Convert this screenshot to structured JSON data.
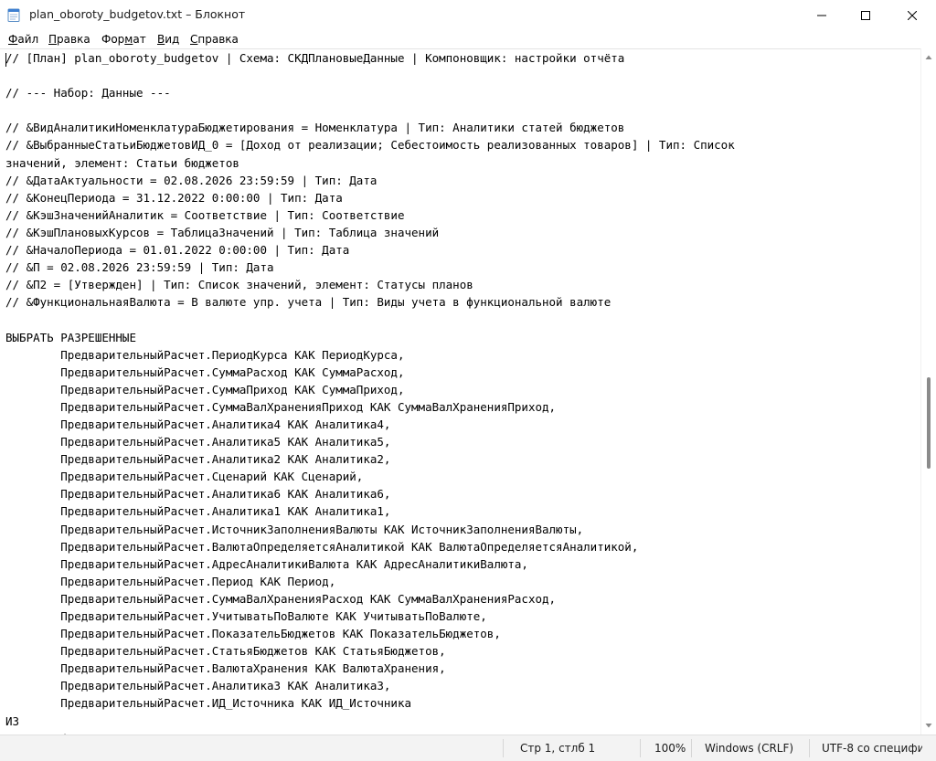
{
  "window": {
    "title": "plan_oboroty_budgetov.txt – Блокнот",
    "icon": "notepad-icon"
  },
  "menu": {
    "items": [
      {
        "underline": "Ф",
        "rest": "айл"
      },
      {
        "underline": "П",
        "rest": "равка"
      },
      {
        "pre": "Фор",
        "underline": "м",
        "rest": "ат"
      },
      {
        "underline": "В",
        "rest": "ид"
      },
      {
        "underline": "С",
        "rest": "правка"
      }
    ]
  },
  "editor": {
    "lines": [
      "// [План] plan_oboroty_budgetov | Схема: СКДПлановыеДанные | Компоновщик: настройки отчёта",
      "",
      "// --- Набор: Данные ---",
      "",
      "// &ВидАналитикиНоменклатураБюджетирования = Номенклатура | Тип: Аналитики статей бюджетов",
      "// &ВыбранныеСтатьиБюджетовИД_0 = [Доход от реализации; Себестоимость реализованных товаров] | Тип: Список",
      "значений, элемент: Статьи бюджетов",
      "// &ДатаАктуальности = 02.08.2026 23:59:59 | Тип: Дата",
      "// &КонецПериода = 31.12.2022 0:00:00 | Тип: Дата",
      "// &КэшЗначенийАналитик = Соответствие | Тип: Соответствие",
      "// &КэшПлановыхКурсов = ТаблицаЗначений | Тип: Таблица значений",
      "// &НачалоПериода = 01.01.2022 0:00:00 | Тип: Дата",
      "// &П = 02.08.2026 23:59:59 | Тип: Дата",
      "// &П2 = [Утвержден] | Тип: Список значений, элемент: Статусы планов",
      "// &ФункциональнаяВалюта = В валюте упр. учета | Тип: Виды учета в функциональной валюте",
      "",
      "ВЫБРАТЬ РАЗРЕШЕННЫЕ",
      "        ПредварительныйРасчет.ПериодКурса КАК ПериодКурса,",
      "        ПредварительныйРасчет.СуммаРасход КАК СуммаРасход,",
      "        ПредварительныйРасчет.СуммаПриход КАК СуммаПриход,",
      "        ПредварительныйРасчет.СуммаВалХраненияПриход КАК СуммаВалХраненияПриход,",
      "        ПредварительныйРасчет.Аналитика4 КАК Аналитика4,",
      "        ПредварительныйРасчет.Аналитика5 КАК Аналитика5,",
      "        ПредварительныйРасчет.Аналитика2 КАК Аналитика2,",
      "        ПредварительныйРасчет.Сценарий КАК Сценарий,",
      "        ПредварительныйРасчет.Аналитика6 КАК Аналитика6,",
      "        ПредварительныйРасчет.Аналитика1 КАК Аналитика1,",
      "        ПредварительныйРасчет.ИсточникЗаполненияВалюты КАК ИсточникЗаполненияВалюты,",
      "        ПредварительныйРасчет.ВалютаОпределяетсяАналитикой КАК ВалютаОпределяетсяАналитикой,",
      "        ПредварительныйРасчет.АдресАналитикиВалюта КАК АдресАналитикиВалюта,",
      "        ПредварительныйРасчет.Период КАК Период,",
      "        ПредварительныйРасчет.СуммаВалХраненияРасход КАК СуммаВалХраненияРасход,",
      "        ПредварительныйРасчет.УчитыватьПоВалюте КАК УчитыватьПоВалюте,",
      "        ПредварительныйРасчет.ПоказательБюджетов КАК ПоказательБюджетов,",
      "        ПредварительныйРасчет.СтатьяБюджетов КАК СтатьяБюджетов,",
      "        ПредварительныйРасчет.ВалютаХранения КАК ВалютаХранения,",
      "        ПредварительныйРасчет.Аналитика3 КАК Аналитика3,",
      "        ПредварительныйРасчет.ИД_Источника КАК ИД_Источника",
      "ИЗ",
      "        (ВЫБРАТЬ"
    ]
  },
  "status": {
    "position": "Стр 1, стлб 1",
    "zoom": "100%",
    "line_endings": "Windows (CRLF)",
    "encoding": "UTF-8 со специфи"
  }
}
